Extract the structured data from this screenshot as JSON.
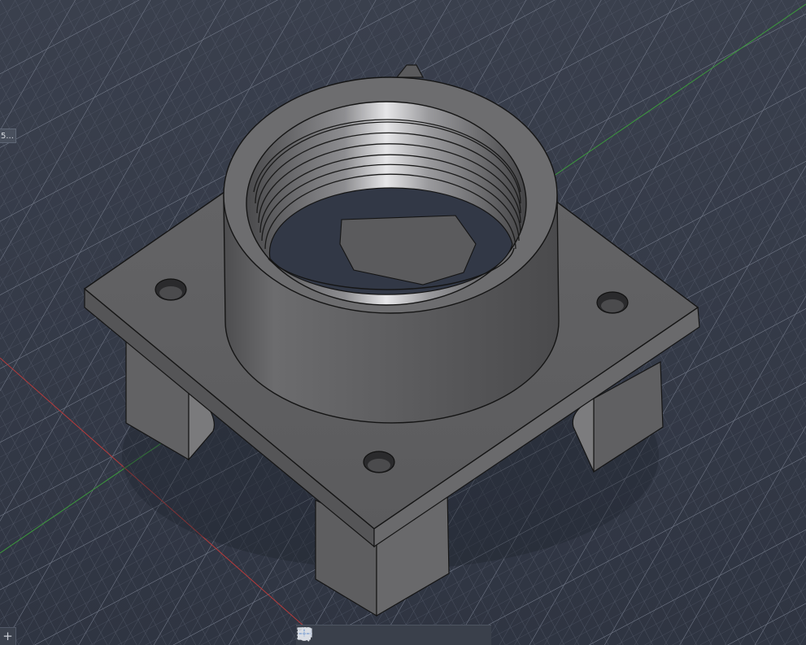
{
  "viewport": {
    "view_label": "5...",
    "corner_button": "+",
    "axis_colors": {
      "x": "#b83a3a",
      "y": "#3c9a3c"
    },
    "model_color": "#5a5a5c"
  },
  "navbar": {
    "items": [
      {
        "icon": "orbit-icon",
        "has_menu": true
      },
      {
        "icon": "look-at-icon",
        "has_menu": false
      },
      {
        "icon": "pan-hand-icon",
        "has_menu": false
      },
      {
        "icon": "zoom-icon",
        "has_menu": false
      },
      {
        "icon": "fit-window-icon",
        "has_menu": true
      },
      {
        "icon": "display-settings-icon",
        "has_menu": true
      },
      {
        "icon": "grid-settings-icon",
        "has_menu": true
      },
      {
        "icon": "viewports-icon",
        "has_menu": true
      }
    ]
  }
}
